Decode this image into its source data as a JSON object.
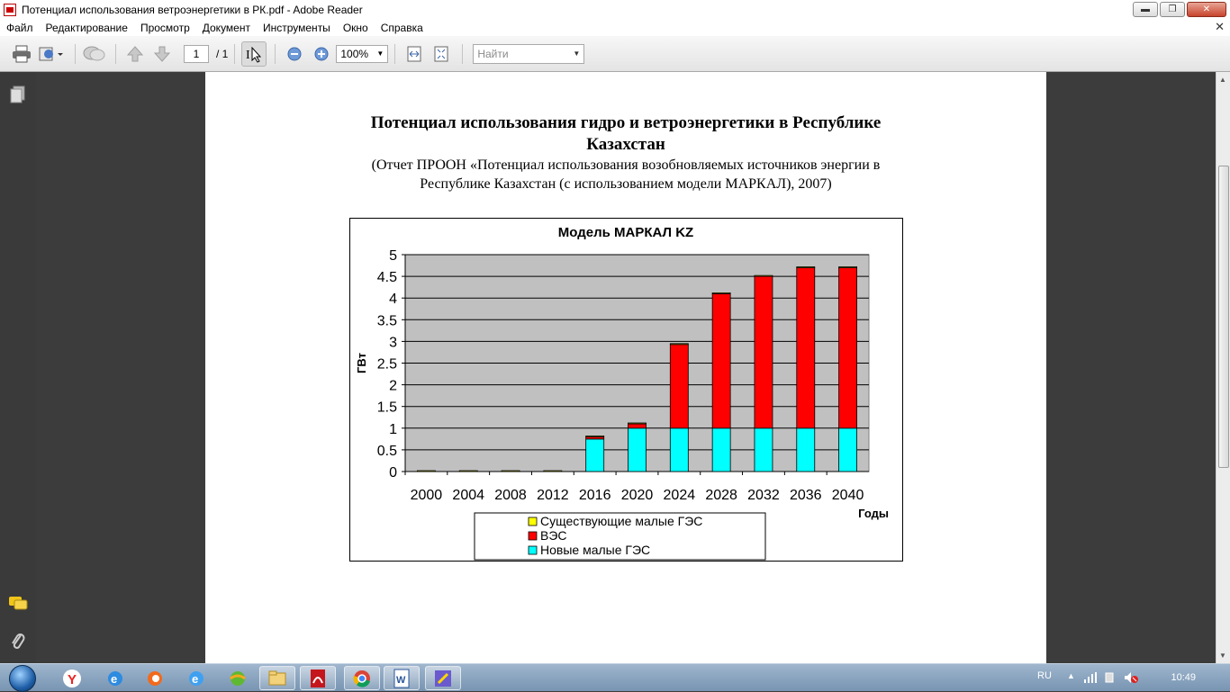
{
  "window": {
    "title": "Потенциал использования ветроэнергетики в РК.pdf - Adobe Reader",
    "minimize_label": "▬",
    "maximize_label": "❐",
    "close_label": "✕"
  },
  "menu": {
    "items": [
      "Файл",
      "Редактирование",
      "Просмотр",
      "Документ",
      "Инструменты",
      "Окно",
      "Справка"
    ],
    "doc_close": "✕"
  },
  "toolbar": {
    "page_current": "1",
    "page_total": "/ 1",
    "zoom": "100%",
    "find_placeholder": "Найти"
  },
  "document": {
    "title_line1": "Потенциал использования гидро и ветроэнергетики в  Республике",
    "title_line2": "Казахстан",
    "subtitle_line1": "(Отчет ПРООН «Потенциал использования возобновляемых источников энергии в",
    "subtitle_line2": "Республике Казахстан (с использованием модели МАРКАЛ), 2007)"
  },
  "chart_data": {
    "type": "bar",
    "stacked": true,
    "title": "Модель МАРКАЛ KZ",
    "xlabel": "Годы",
    "ylabel": "ГВт",
    "ylim": [
      0,
      5
    ],
    "yticks": [
      "0",
      "0.5",
      "1",
      "1.5",
      "2",
      "2.5",
      "3",
      "3.5",
      "4",
      "4.5",
      "5"
    ],
    "categories": [
      "2000",
      "2004",
      "2008",
      "2012",
      "2016",
      "2020",
      "2024",
      "2028",
      "2032",
      "2036",
      "2040"
    ],
    "series": [
      {
        "name": "Новые малые ГЭС",
        "color": "#00ffff",
        "values": [
          0,
          0,
          0,
          0,
          0.75,
          1.0,
          1.0,
          1.0,
          1.0,
          1.0,
          1.0
        ]
      },
      {
        "name": "ВЭС",
        "color": "#ff0000",
        "values": [
          0,
          0,
          0,
          0,
          0.05,
          0.1,
          1.93,
          3.1,
          3.5,
          3.7,
          3.7
        ]
      },
      {
        "name": "Существующие малые ГЭС",
        "color": "#ffff00",
        "values": [
          0.02,
          0.02,
          0.02,
          0.02,
          0.02,
          0.02,
          0.02,
          0.02,
          0.02,
          0.02,
          0.02
        ]
      }
    ],
    "legend_order": [
      "Существующие малые ГЭС",
      "ВЭС",
      "Новые малые ГЭС"
    ],
    "plot_background": "#c0c0c0",
    "grid": true,
    "legend": "bottom"
  },
  "taskbar": {
    "language": "RU",
    "time": "10:49"
  }
}
